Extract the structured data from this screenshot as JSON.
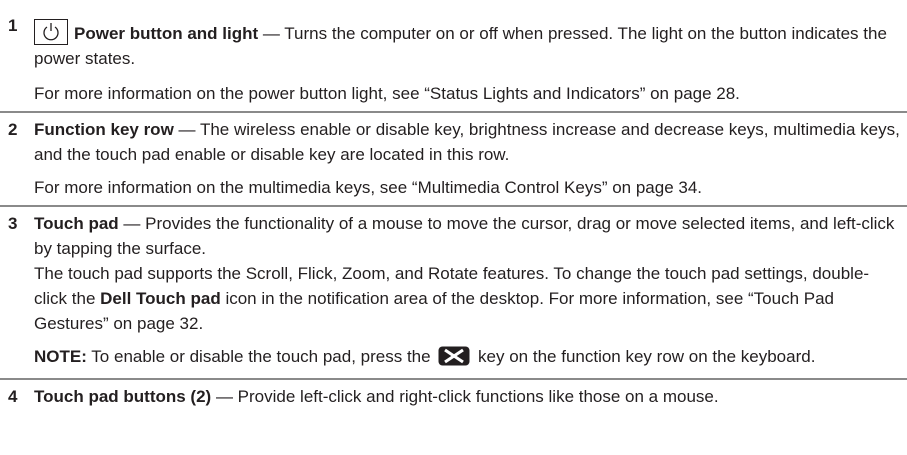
{
  "item1": {
    "number": "1",
    "title": "Power button and light",
    "dash": " — ",
    "desc": "Turns the computer on or off when pressed. The light on the button indicates the power states.",
    "more": "For more information on the power button light, see “Status Lights and Indicators” on page 28."
  },
  "item2": {
    "number": "2",
    "title": "Function key row",
    "dash": " — ",
    "desc": "The wireless enable or disable key, brightness increase and decrease keys, multimedia keys, and the touch pad enable or disable key are located in this row.",
    "more": "For more information on the multimedia keys, see “Multimedia Control Keys” on page 34."
  },
  "item3": {
    "number": "3",
    "title": "Touch pad",
    "dash": " — ",
    "desc": "Provides the functionality of a mouse to move the cursor, drag or move selected items, and left-click by tapping the surface.",
    "p2_a": "The touch pad supports the Scroll, Flick, Zoom, and Rotate features. To change the touch pad settings, double-click the ",
    "p2_bold": "Dell Touch pad",
    "p2_b": " icon in the notification area of the desktop. For more information, see “Touch Pad Gestures” on page 32.",
    "note_label": "NOTE:",
    "note_a": " To enable or disable the touch pad, press the ",
    "note_b": " key on the function key row on the keyboard."
  },
  "item4": {
    "number": "4",
    "title": "Touch pad buttons (2)",
    "dash": " — ",
    "desc": "Provide left-click and right-click functions like those on a mouse."
  }
}
